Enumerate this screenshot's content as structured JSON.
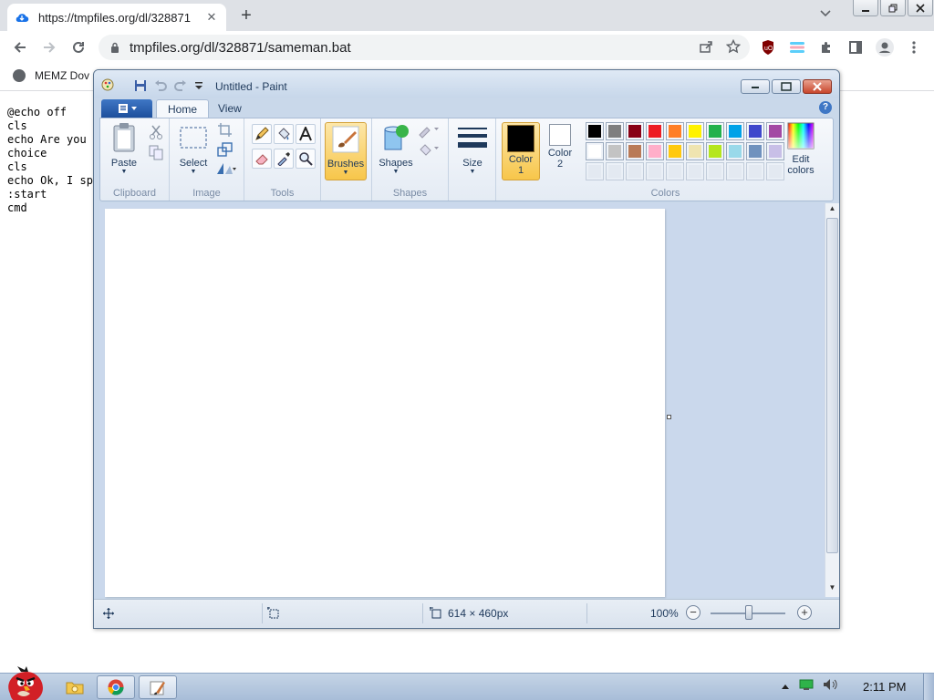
{
  "browser": {
    "tab_title": "https://tmpfiles.org/dl/328871",
    "tab_close": "✕",
    "new_tab": "+",
    "url": "tmpfiles.org/dl/328871/sameman.bat",
    "bookmark_label": "MEMZ Dov"
  },
  "page": {
    "lines": "@echo off\ncls\necho Are you\nchoice\ncls\necho Ok, I sp\n:start\ncmd"
  },
  "paint": {
    "title": "Untitled - Paint",
    "tabs": {
      "home": "Home",
      "view": "View"
    },
    "help": "?",
    "groups": {
      "clipboard": "Clipboard",
      "image": "Image",
      "tools": "Tools",
      "shapes": "Shapes",
      "colors": "Colors"
    },
    "buttons": {
      "paste": "Paste",
      "select": "Select",
      "brushes": "Brushes",
      "shapes": "Shapes",
      "size": "Size",
      "color1_a": "Color",
      "color1_b": "1",
      "color2_a": "Color",
      "color2_b": "2",
      "edit_colors_a": "Edit",
      "edit_colors_b": "colors"
    },
    "color1": "#000000",
    "color2": "#ffffff",
    "palette_row1": [
      "#000000",
      "#7f7f7f",
      "#880015",
      "#ed1c24",
      "#ff7f27",
      "#fff200",
      "#22b14c",
      "#00a2e8",
      "#3f48cc",
      "#a349a4"
    ],
    "palette_row2": [
      "#ffffff",
      "#c3c3c3",
      "#b97a57",
      "#ffaec9",
      "#ffc90e",
      "#efe4b0",
      "#b5e61d",
      "#99d9ea",
      "#7092be",
      "#c8bfe7"
    ],
    "status": {
      "size": "614 × 460px",
      "zoom": "100%"
    }
  },
  "taskbar": {
    "clock": "2:11 PM"
  }
}
